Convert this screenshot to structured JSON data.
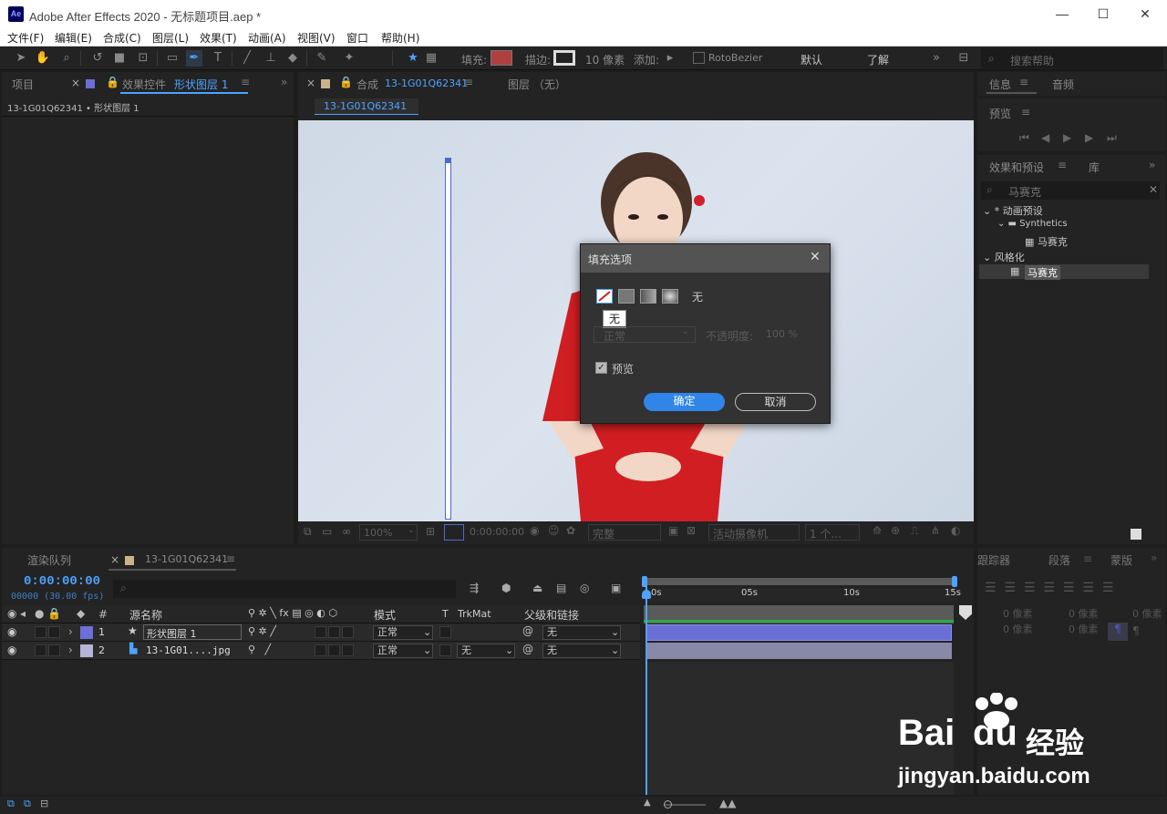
{
  "window": {
    "title": "Adobe After Effects 2020 - 无标题项目.aep *",
    "logo": "Ae"
  },
  "menu": [
    "文件(F)",
    "编辑(E)",
    "合成(C)",
    "图层(L)",
    "效果(T)",
    "动画(A)",
    "视图(V)",
    "窗口",
    "帮助(H)"
  ],
  "toolbar": {
    "fill_label": "填充:",
    "stroke_label": "描边:",
    "stroke_px": "10 像素",
    "add_label": "添加:",
    "rotobezier": "RotoBezier",
    "workspace_default": "默认",
    "workspace_learn": "了解",
    "search_help": "搜索帮助"
  },
  "project_panel": {
    "tab": "项目",
    "effects_tab": "效果控件",
    "effects_layer": "形状图层 1",
    "breadcrumb": "13-1G01Q62341 • 形状图层 1"
  },
  "comp_panel": {
    "tab_prefix": "合成",
    "tab_name": "13-1G01Q62341",
    "layer_tab": "图层 （无）",
    "subtab": "13-1G01Q62341",
    "zoom": "100%",
    "timecode": "0:00:00:00",
    "quality": "完整",
    "camera": "活动摄像机",
    "views": "1 个..."
  },
  "dialog": {
    "title": "填充选项",
    "fill_type_label": "无",
    "tooltip": "无",
    "mode": "正常",
    "opacity_label": "不透明度:",
    "opacity_value": "100 %",
    "preview_label": "预览",
    "ok": "确定",
    "cancel": "取消"
  },
  "right_panel": {
    "info_tab": "信息",
    "audio_tab": "音频",
    "preview_tab": "预览",
    "effects_tab": "效果和预设",
    "library_tab": "库",
    "search_value": "马赛克",
    "tree": [
      {
        "label": "* 动画预设",
        "indent": 0
      },
      {
        "label": "Synthetics",
        "indent": 1
      },
      {
        "label": "马赛克",
        "indent": 2
      },
      {
        "label": "风格化",
        "indent": 0
      },
      {
        "label": "马赛克",
        "indent": 1
      }
    ]
  },
  "paragraph_panel": {
    "tracker_tab": "跟踪器",
    "paragraph_tab": "段落",
    "mask_tab": "蒙版",
    "px_values": [
      "0 像素",
      "0 像素",
      "0 像素",
      "0 像素",
      "0 像素"
    ]
  },
  "timeline": {
    "render_tab": "渲染队列",
    "comp_tab": "13-1G01Q62341",
    "timecode": "0:00:00:00",
    "fps": "00000 (30.00 fps)",
    "columns": {
      "num": "#",
      "source": "源名称",
      "mode": "模式",
      "t": "T",
      "trkmat": "TrkMat",
      "parent": "父级和链接"
    },
    "ruler": [
      "0s",
      "05s",
      "10s",
      "15s"
    ],
    "layers": [
      {
        "num": "1",
        "name": "形状图层 1",
        "mode": "正常",
        "trkmat": "",
        "parent": "无",
        "color": "#6b6fd6"
      },
      {
        "num": "2",
        "name": "13-1G01....jpg",
        "mode": "正常",
        "trkmat": "无",
        "parent": "无",
        "color": "#b4b4d8"
      }
    ]
  },
  "watermark": {
    "brand": "Bai",
    "brand2": "du",
    "cn": "经验",
    "url": "jingyan.baidu.com"
  }
}
